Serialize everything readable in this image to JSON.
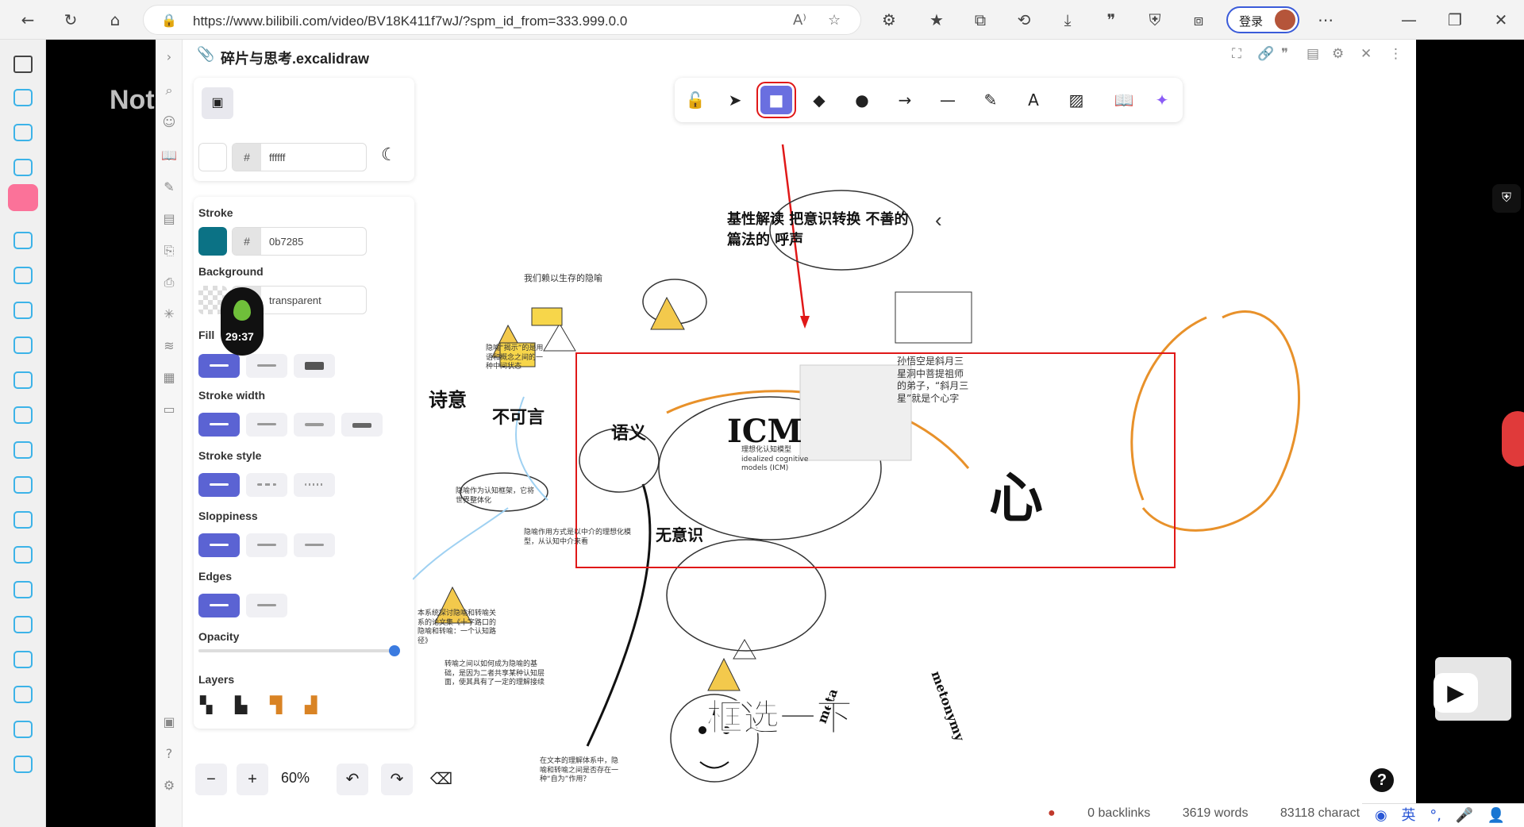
{
  "browser": {
    "url": "https://www.bilibili.com/video/BV18K411f7wJ/?spm_id_from=333.999.0.0",
    "login_label": "登录"
  },
  "video": {
    "watermark": "Notes剪映 bilibili",
    "subtitle": "框选一下",
    "timer": "29:37"
  },
  "app": {
    "file_title": "碎片与思考.excalidraw",
    "canvas_bg_hex": "ffffff",
    "stroke_label": "Stroke",
    "stroke_hex": "0b7285",
    "stroke_color": "#0b7285",
    "background_label": "Background",
    "background_value": "transparent",
    "fill_label": "Fill",
    "stroke_width_label": "Stroke width",
    "stroke_style_label": "Stroke style",
    "sloppiness_label": "Sloppiness",
    "edges_label": "Edges",
    "opacity_label": "Opacity",
    "layers_label": "Layers",
    "zoom": "60%",
    "accent_color": "#5b63d3"
  },
  "canvas": {
    "icm_label": "ICM",
    "icm_sub": "理想化认知模型 idealized cognitive models (ICM)",
    "heart_char": "心",
    "note_sun": "孙悟空是斜月三星洞中菩提祖师的弟子，“斜月三星”就是个心字",
    "note_survive": "我们赖以生存的隐喻",
    "note_metaphor": "隐喻“揭示”的是用语和概念之间的一种中间状态",
    "note_framework": "隐喻作为认知框架，它将世界整体化",
    "note_icm_desc": "隐喻作用方式是以中介的理想化模型，从认知中介来看",
    "note_essay": "本系统探讨隐喻和转喻关系的论文集《十字路口的隐喻和转喻：一个认知路径》",
    "note_bottom": "在文本的理解体系中，隐喻和转喻之间是否存在一种“自为”作用？",
    "note_metonymy": "转喻之间以如何成为隐喻的基础，是因为二者共享某种认知层面，使其具有了一定的理解接续",
    "hw_yuyi": "语义",
    "hw_bukeyan": "不可言",
    "hw_shiyi": "诗意",
    "hw_kongjian": "无意识",
    "hw_top": "基性解读 把意识转换 不善的 篇法的 呼声",
    "hw_meta": "meta",
    "hw_metonymy": "metonymy"
  },
  "status": {
    "backlinks": "0 backlinks",
    "words": "3619 words",
    "chars": "83118 charact"
  }
}
